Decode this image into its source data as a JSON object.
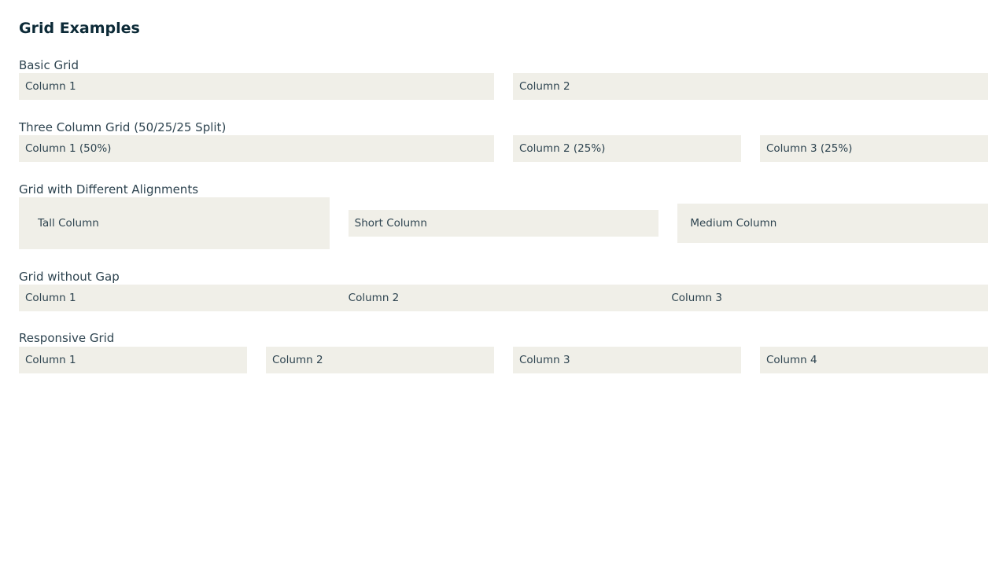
{
  "page": {
    "title": "Grid Examples"
  },
  "sections": {
    "basic": {
      "label": "Basic Grid",
      "columns": [
        "Column 1",
        "Column 2"
      ]
    },
    "three": {
      "label": "Three Column Grid (50/25/25 Split)",
      "columns": [
        "Column 1 (50%)",
        "Column 2 (25%)",
        "Column 3 (25%)"
      ]
    },
    "alignments": {
      "label": "Grid with Different Alignments",
      "columns": [
        "Tall Column",
        "Short Column",
        "Medium Column"
      ]
    },
    "no_gap": {
      "label": "Grid without Gap",
      "columns": [
        "Column 1",
        "Column 2",
        "Column 3"
      ]
    },
    "responsive": {
      "label": "Responsive Grid",
      "columns": [
        "Column 1",
        "Column 2",
        "Column 3",
        "Column 4"
      ]
    }
  },
  "colors": {
    "cell_background": "#f0efe8",
    "title_text": "#0c2a37",
    "body_text": "#2e4450"
  }
}
